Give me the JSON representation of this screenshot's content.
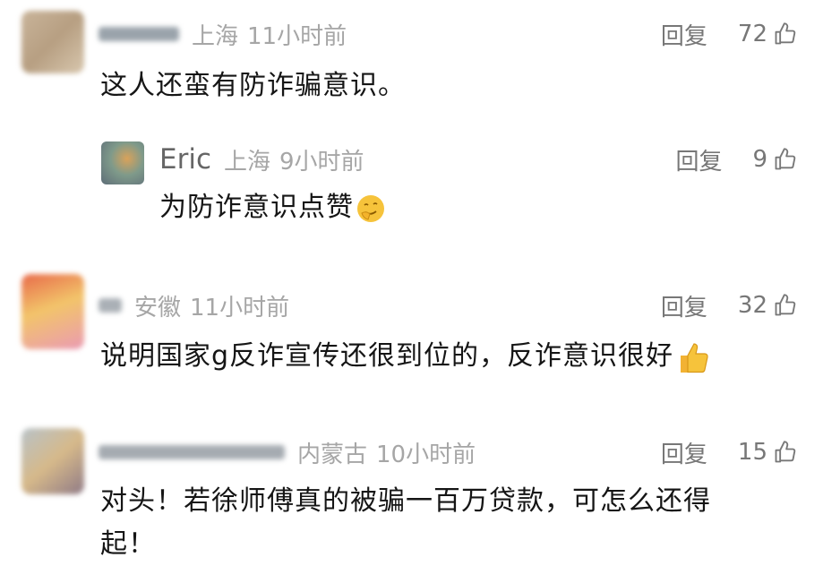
{
  "comments": [
    {
      "location": "上海",
      "time": "11小时前",
      "reply": "回复",
      "likes": "72",
      "text": "这人还蛮有防诈骗意识。",
      "colors": [
        "#c9b49a",
        "#b79f82",
        "#d8c7ae"
      ]
    },
    {
      "name": "Eric",
      "location": "上海",
      "time": "9小时前",
      "reply": "回复",
      "likes": "9",
      "text": "为防诈意识点赞",
      "emoji": "smirk-face-icon"
    },
    {
      "location": "安徽",
      "time": "11小时前",
      "reply": "回复",
      "likes": "32",
      "text": "说明国家g反诈宣传还很到位的，反诈意识很好",
      "emoji": "thumbs-up-icon",
      "colors": [
        "#e86a4a",
        "#f2c46a",
        "#ea9ab3"
      ]
    },
    {
      "location": "内蒙古",
      "time": "10小时前",
      "reply": "回复",
      "likes": "15",
      "text_line1": "对头！若徐师傅真的被骗一百万贷款，可怎么还得",
      "text_line2": "起！",
      "colors": [
        "#b8c2c8",
        "#d6b98a",
        "#8f7a86"
      ]
    }
  ]
}
